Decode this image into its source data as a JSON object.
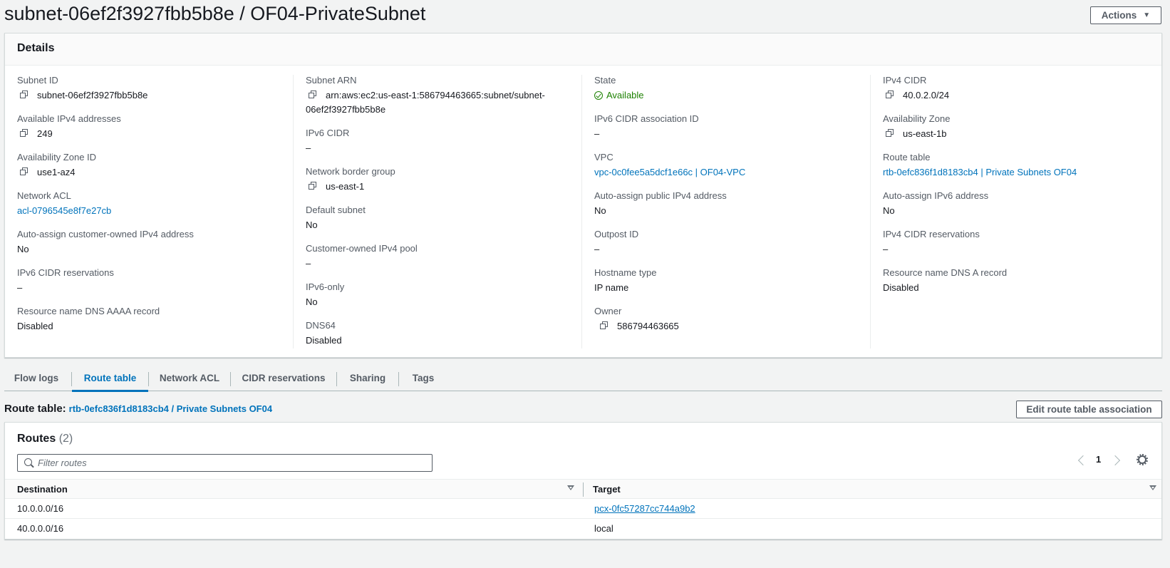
{
  "page": {
    "title": "subnet-06ef2f3927fbb5b8e / OF04-PrivateSubnet",
    "actions_label": "Actions"
  },
  "details": {
    "title": "Details",
    "subnet_id": {
      "label": "Subnet ID",
      "value": "subnet-06ef2f3927fbb5b8e"
    },
    "available_ipv4": {
      "label": "Available IPv4 addresses",
      "value": "249"
    },
    "az_id": {
      "label": "Availability Zone ID",
      "value": "use1-az4"
    },
    "network_acl": {
      "label": "Network ACL",
      "value": "acl-0796545e8f7e27cb"
    },
    "auto_assign_customer_ipv4": {
      "label": "Auto-assign customer-owned IPv4 address",
      "value": "No"
    },
    "ipv6_cidr_reservations": {
      "label": "IPv6 CIDR reservations",
      "value": "–"
    },
    "dns_aaaa": {
      "label": "Resource name DNS AAAA record",
      "value": "Disabled"
    },
    "subnet_arn": {
      "label": "Subnet ARN",
      "value_line1": "arn:aws:ec2:us-east-1:586794463665:subnet/subnet-",
      "value_line2": "06ef2f3927fbb5b8e"
    },
    "ipv6_cidr": {
      "label": "IPv6 CIDR",
      "value": "–"
    },
    "network_border_group": {
      "label": "Network border group",
      "value": "us-east-1"
    },
    "default_subnet": {
      "label": "Default subnet",
      "value": "No"
    },
    "customer_ipv4_pool": {
      "label": "Customer-owned IPv4 pool",
      "value": "–"
    },
    "ipv6_only": {
      "label": "IPv6-only",
      "value": "No"
    },
    "dns64": {
      "label": "DNS64",
      "value": "Disabled"
    },
    "state": {
      "label": "State",
      "value": "Available"
    },
    "ipv6_assoc_id": {
      "label": "IPv6 CIDR association ID",
      "value": "–"
    },
    "vpc": {
      "label": "VPC",
      "value": "vpc-0c0fee5a5dcf1e66c | OF04-VPC"
    },
    "auto_assign_public_ipv4": {
      "label": "Auto-assign public IPv4 address",
      "value": "No"
    },
    "outpost_id": {
      "label": "Outpost ID",
      "value": "–"
    },
    "hostname_type": {
      "label": "Hostname type",
      "value": "IP name"
    },
    "owner": {
      "label": "Owner",
      "value": "586794463665"
    },
    "ipv4_cidr": {
      "label": "IPv4 CIDR",
      "value": "40.0.2.0/24"
    },
    "az": {
      "label": "Availability Zone",
      "value": "us-east-1b"
    },
    "route_table": {
      "label": "Route table",
      "value": "rtb-0efc836f1d8183cb4 | Private Subnets OF04"
    },
    "auto_assign_ipv6": {
      "label": "Auto-assign IPv6 address",
      "value": "No"
    },
    "ipv4_cidr_reservations": {
      "label": "IPv4 CIDR reservations",
      "value": "–"
    },
    "dns_a": {
      "label": "Resource name DNS A record",
      "value": "Disabled"
    }
  },
  "tabs": [
    {
      "label": "Flow logs"
    },
    {
      "label": "Route table"
    },
    {
      "label": "Network ACL"
    },
    {
      "label": "CIDR reservations"
    },
    {
      "label": "Sharing"
    },
    {
      "label": "Tags"
    }
  ],
  "route_table_section": {
    "heading_label": "Route table:",
    "heading_link": "rtb-0efc836f1d8183cb4 / Private Subnets OF04",
    "edit_button": "Edit route table association"
  },
  "routes": {
    "title": "Routes",
    "count": "(2)",
    "filter_placeholder": "Filter routes",
    "page_number": "1",
    "columns": {
      "destination": "Destination",
      "target": "Target"
    },
    "rows": [
      {
        "destination": "10.0.0.0/16",
        "target": "pcx-0fc57287cc744a9b2"
      },
      {
        "destination": "40.0.0.0/16",
        "target": "local"
      }
    ]
  }
}
